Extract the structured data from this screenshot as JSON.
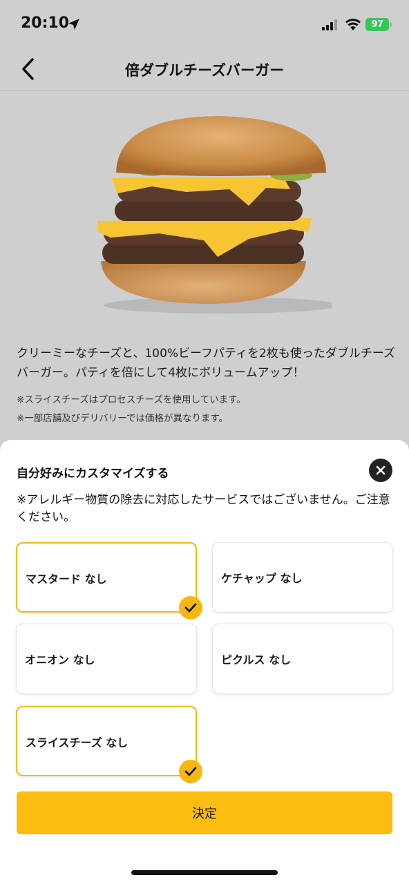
{
  "status_bar": {
    "time": "20:10",
    "battery": "97",
    "icons": [
      "location-arrow-icon",
      "signal-icon",
      "wifi-icon",
      "battery-icon"
    ],
    "battery_color": "#34c759"
  },
  "nav": {
    "title": "倍ダブルチーズバーガー",
    "back_icon": "chevron-left-icon"
  },
  "product": {
    "description": "クリーミーなチーズと、100%ビーフパティを2枚も使ったダブルチーズバーガー。パティを倍にして4枚にボリュームアップ！",
    "notes": [
      "※スライスチーズはプロセスチーズを使用しています。",
      "※一部店舗及びデリバリーでは価格が異なります。"
    ]
  },
  "sheet": {
    "title": "自分好みにカスタマイズする",
    "notice": "※アレルギー物質の除去に対応したサービスではございません。ご注意ください。",
    "close_icon": "close-icon",
    "options": [
      {
        "label": "マスタード なし",
        "selected": true
      },
      {
        "label": "ケチャップ なし",
        "selected": false
      },
      {
        "label": "オニオン なし",
        "selected": false
      },
      {
        "label": "ピクルス なし",
        "selected": false
      },
      {
        "label": "スライスチーズ なし",
        "selected": true
      }
    ],
    "confirm_label": "決定"
  },
  "colors": {
    "accent": "#fcbc10",
    "selected_border": "#f6b80f",
    "backdrop": "#cfcfcf"
  }
}
